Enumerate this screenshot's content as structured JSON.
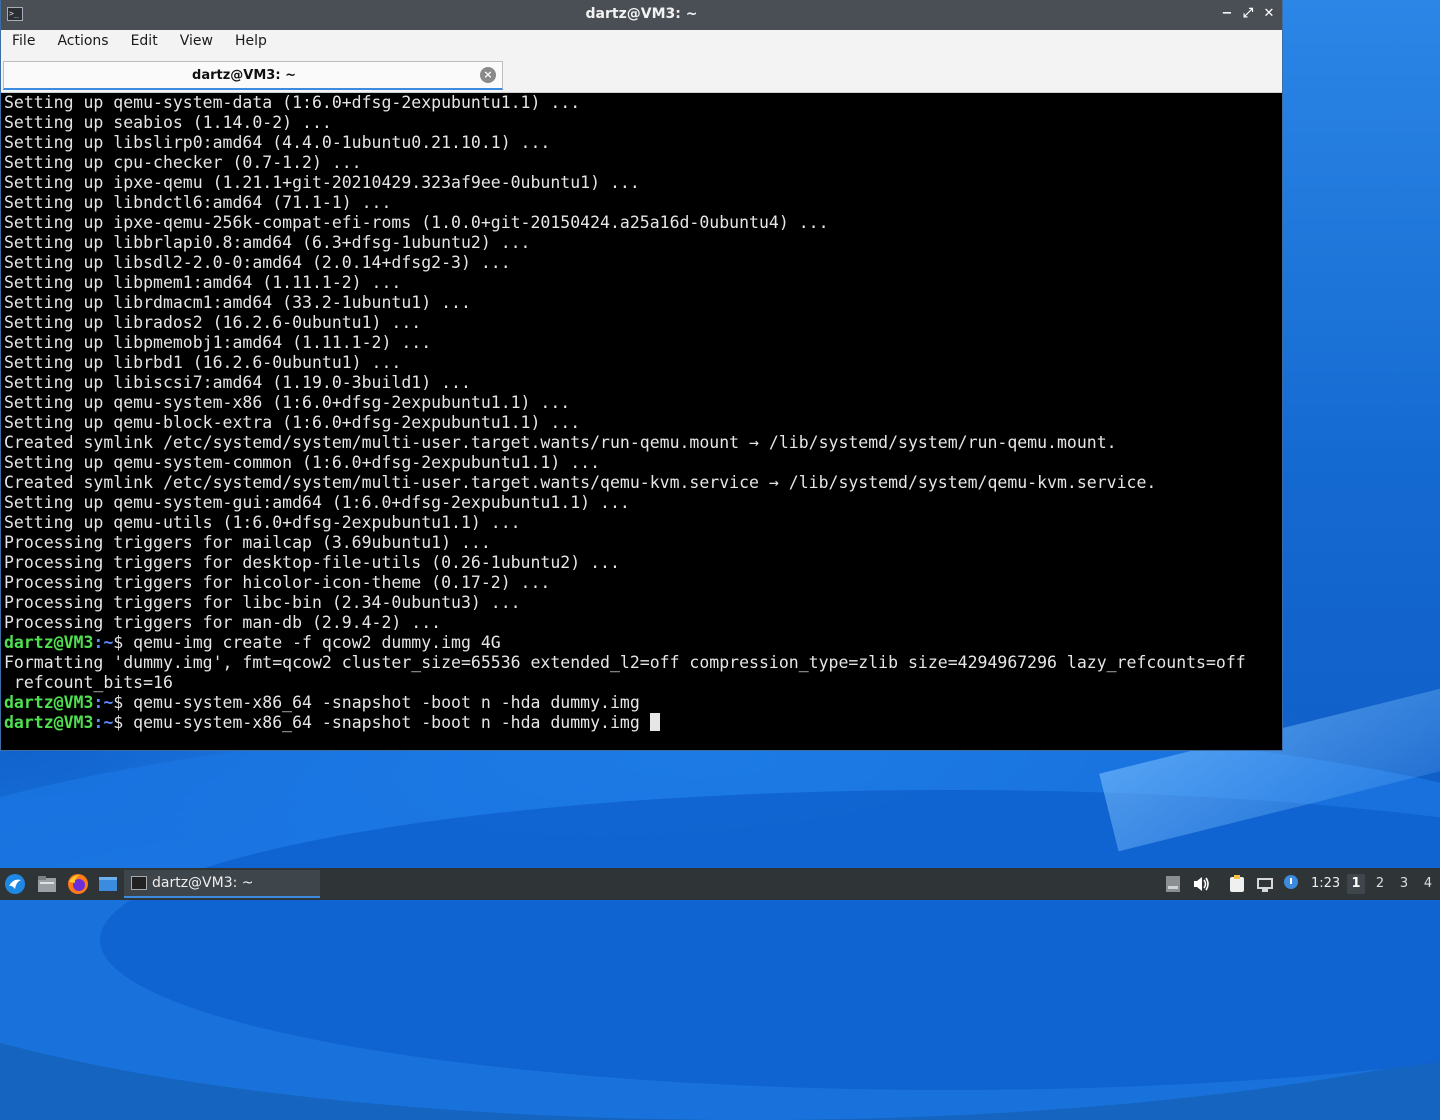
{
  "window": {
    "title": "dartz@VM3: ~",
    "controls": {
      "minimize": "−",
      "maximize": "⤢",
      "close": "✕"
    }
  },
  "menu": [
    "File",
    "Actions",
    "Edit",
    "View",
    "Help"
  ],
  "tab": {
    "label": "dartz@VM3: ~",
    "close": "×"
  },
  "terminal": {
    "prompt_user": "dartz@VM3",
    "prompt_path": ":~",
    "prompt_sym": "$ ",
    "lines": [
      "Setting up qemu-system-data (1:6.0+dfsg-2expubuntu1.1) ...",
      "Setting up seabios (1.14.0-2) ...",
      "Setting up libslirp0:amd64 (4.4.0-1ubuntu0.21.10.1) ...",
      "Setting up cpu-checker (0.7-1.2) ...",
      "Setting up ipxe-qemu (1.21.1+git-20210429.323af9ee-0ubuntu1) ...",
      "Setting up libndctl6:amd64 (71.1-1) ...",
      "Setting up ipxe-qemu-256k-compat-efi-roms (1.0.0+git-20150424.a25a16d-0ubuntu4) ...",
      "Setting up libbrlapi0.8:amd64 (6.3+dfsg-1ubuntu2) ...",
      "Setting up libsdl2-2.0-0:amd64 (2.0.14+dfsg2-3) ...",
      "Setting up libpmem1:amd64 (1.11.1-2) ...",
      "Setting up librdmacm1:amd64 (33.2-1ubuntu1) ...",
      "Setting up librados2 (16.2.6-0ubuntu1) ...",
      "Setting up libpmemobj1:amd64 (1.11.1-2) ...",
      "Setting up librbd1 (16.2.6-0ubuntu1) ...",
      "Setting up libiscsi7:amd64 (1.19.0-3build1) ...",
      "Setting up qemu-system-x86 (1:6.0+dfsg-2expubuntu1.1) ...",
      "Setting up qemu-block-extra (1:6.0+dfsg-2expubuntu1.1) ...",
      "Created symlink /etc/systemd/system/multi-user.target.wants/run-qemu.mount → /lib/systemd/system/run-qemu.mount.",
      "Setting up qemu-system-common (1:6.0+dfsg-2expubuntu1.1) ...",
      "Created symlink /etc/systemd/system/multi-user.target.wants/qemu-kvm.service → /lib/systemd/system/qemu-kvm.service.",
      "Setting up qemu-system-gui:amd64 (1:6.0+dfsg-2expubuntu1.1) ...",
      "Setting up qemu-utils (1:6.0+dfsg-2expubuntu1.1) ...",
      "Processing triggers for mailcap (3.69ubuntu1) ...",
      "Processing triggers for desktop-file-utils (0.26-1ubuntu2) ...",
      "Processing triggers for hicolor-icon-theme (0.17-2) ...",
      "Processing triggers for libc-bin (2.34-0ubuntu3) ...",
      "Processing triggers for man-db (2.9.4-2) ..."
    ],
    "cmd1": "qemu-img create -f qcow2 dummy.img 4G",
    "out1a": "Formatting 'dummy.img', fmt=qcow2 cluster_size=65536 extended_l2=off compression_type=zlib size=4294967296 lazy_refcounts=off",
    "out1b": " refcount_bits=16",
    "cmd2": "qemu-system-x86_64 -snapshot -boot n -hda dummy.img",
    "cmd3": "qemu-system-x86_64 -snapshot -boot n -hda dummy.img "
  },
  "taskbar": {
    "launchers": [
      "start-menu-icon",
      "file-manager-icon",
      "firefox-icon",
      "show-desktop-icon"
    ],
    "task_label": "dartz@VM3: ~",
    "clock": "1:23",
    "workspaces": [
      "1",
      "2",
      "3",
      "4"
    ],
    "active_workspace": "1"
  }
}
